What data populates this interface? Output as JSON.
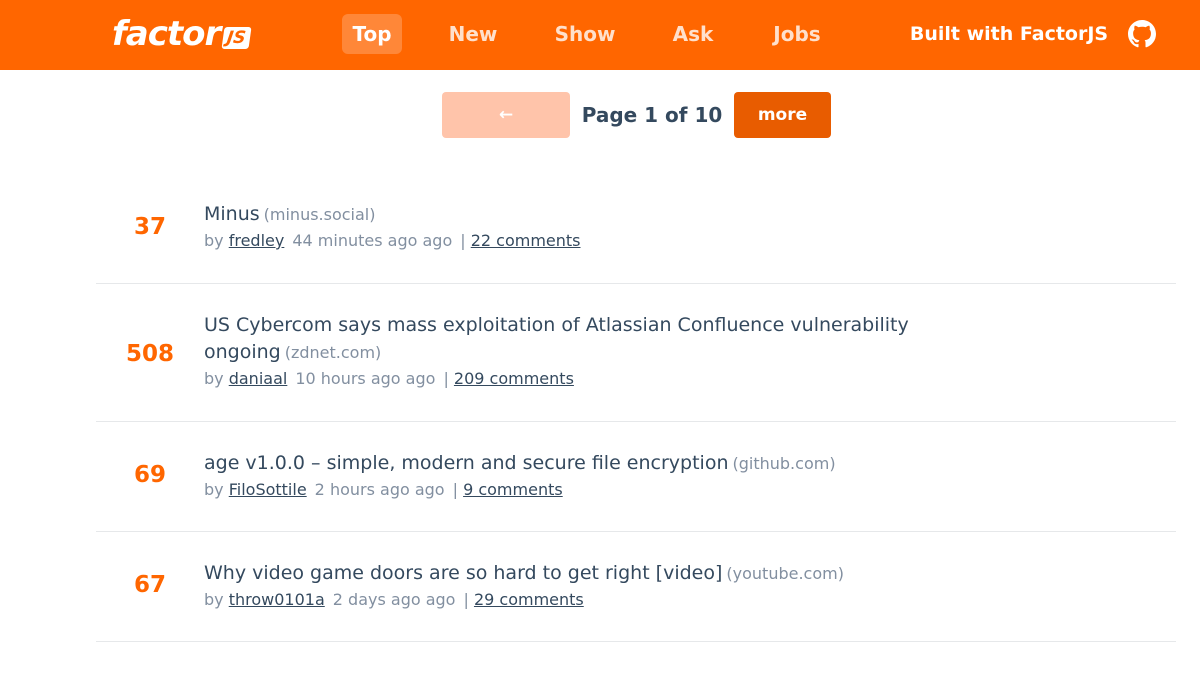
{
  "header": {
    "logo_text": "factor",
    "logo_badge": "JS",
    "nav": [
      {
        "label": "Top",
        "active": true
      },
      {
        "label": "New",
        "active": false
      },
      {
        "label": "Show",
        "active": false
      },
      {
        "label": "Ask",
        "active": false
      },
      {
        "label": "Jobs",
        "active": false
      }
    ],
    "built_with": "Built with FactorJS",
    "github_icon": "github-icon"
  },
  "pager": {
    "prev_label": "← Previous",
    "page_label": "Page 1 of 10",
    "next_label": "more →"
  },
  "items": [
    {
      "score": "37",
      "title": "Minus",
      "host": "(minus.social)",
      "by": "by",
      "user": "fredley",
      "time": "44 minutes ago ago",
      "sep": "|",
      "comments": "22 comments"
    },
    {
      "score": "508",
      "title": "US Cybercom says mass exploitation of Atlassian Confluence vulnerability ongoing",
      "host": "(zdnet.com)",
      "by": "by",
      "user": "daniaal",
      "time": "10 hours ago ago",
      "sep": "|",
      "comments": "209 comments"
    },
    {
      "score": "69",
      "title": "age v1.0.0 – simple, modern and secure file encryption",
      "host": "(github.com)",
      "by": "by",
      "user": "FiloSottile",
      "time": "2 hours ago ago",
      "sep": "|",
      "comments": "9 comments"
    },
    {
      "score": "67",
      "title": "Why video game doors are so hard to get right [video]",
      "host": "(youtube.com)",
      "by": "by",
      "user": "throw0101a",
      "time": "2 days ago ago",
      "sep": "|",
      "comments": "29 comments"
    }
  ],
  "colors": {
    "accent": "#ff6600",
    "text": "#34495e",
    "muted": "#828fa0",
    "prev_button": "#ffc4aa",
    "next_button": "#e85c00"
  }
}
